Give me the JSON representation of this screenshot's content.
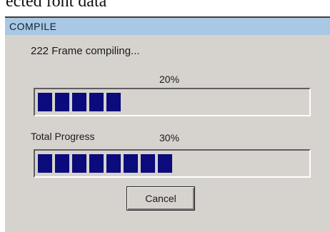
{
  "clipped_caption": "ected font data",
  "dialog": {
    "title": "COMPILE",
    "status_text": "222 Frame compiling...",
    "frame_progress": {
      "percent_label": "20%",
      "percent": 30,
      "color": "#0b0b7c"
    },
    "total_progress": {
      "label": "Total Progress",
      "percent_label": "30%",
      "percent": 50,
      "color": "#0b0b7c"
    },
    "cancel_label": "Cancel"
  },
  "colors": {
    "titlebar": "#a9c8e4",
    "dialog_face": "#d6d3ce"
  }
}
